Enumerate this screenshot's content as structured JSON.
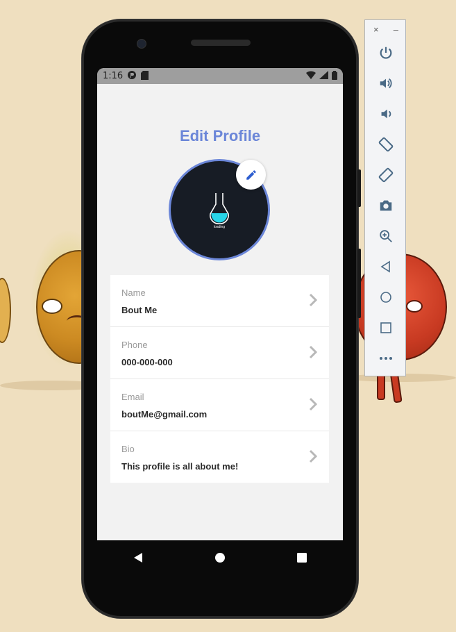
{
  "colors": {
    "accent": "#6b86d8",
    "screen_bg": "#f2f2f2",
    "status_bar": "#9e9e9e",
    "avatar_bg": "#171c25",
    "liquid": "#27d4e8",
    "toolbar_icon": "#4a6a86"
  },
  "status_bar": {
    "time": "1:16",
    "icons": [
      "p-icon",
      "sd-card-icon",
      "wifi-icon",
      "signal-icon",
      "battery-icon"
    ]
  },
  "page": {
    "title": "Edit Profile",
    "avatar_text": "loading",
    "edit_icon": "pencil-icon"
  },
  "fields": [
    {
      "label": "Name",
      "value": "Bout Me"
    },
    {
      "label": "Phone",
      "value": "000-000-000"
    },
    {
      "label": "Email",
      "value": "boutMe@gmail.com"
    },
    {
      "label": "Bio",
      "value": "This profile is all about me!"
    }
  ],
  "navbar": [
    "back-icon",
    "home-icon",
    "recents-icon"
  ],
  "emulator_toolbar": {
    "window_controls": [
      "×",
      "–"
    ],
    "buttons": [
      "power-icon",
      "volume-up-icon",
      "volume-down-icon",
      "rotate-left-icon",
      "rotate-right-icon",
      "camera-icon",
      "zoom-icon",
      "back-icon",
      "home-icon",
      "overview-icon",
      "more-icon"
    ]
  }
}
